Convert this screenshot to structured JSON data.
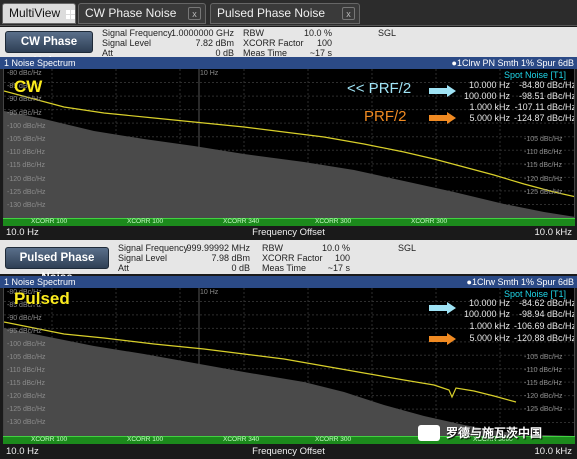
{
  "tabs": [
    {
      "label": "MultiView"
    },
    {
      "label": "CW Phase Noise"
    },
    {
      "label": "Pulsed Phase Noise"
    }
  ],
  "panels": [
    {
      "mode_button": "CW Phase Noise",
      "settings": [
        {
          "label": "Signal Frequency",
          "value": "1.0000000 GHz"
        },
        {
          "label": "Signal Level",
          "value": "7.82 dBm"
        },
        {
          "label": "Att",
          "value": "0 dB"
        },
        {
          "label": "RBW",
          "value": "10.0 %"
        },
        {
          "label": "XCORR Factor",
          "value": "100"
        },
        {
          "label": "Meas Time",
          "value": "~17 s"
        }
      ],
      "sgl": "SGL",
      "spectrum_title": "1 Noise Spectrum",
      "trace_info": "1Clrw PN Smth 1% Spur 6dB",
      "big_label": "CW",
      "y_ticks": [
        "-80 dBc/Hz",
        "-85 dBc/Hz",
        "-90 dBc/Hz",
        "-95 dBc/Hz",
        "-100 dBc/Hz",
        "-105 dBc/Hz",
        "-110 dBc/Hz",
        "-115 dBc/Hz",
        "-120 dBc/Hz",
        "-125 dBc/Hz",
        "-130 dBc/Hz"
      ],
      "top_tick": "10 Hz",
      "spot_title": "Spot Noise [T1]",
      "spot": [
        {
          "f": "10.000 Hz",
          "v": "-84.80 dBc/Hz"
        },
        {
          "f": "100.000 Hz",
          "v": "-98.51 dBc/Hz"
        },
        {
          "f": "1.000 kHz",
          "v": "-107.11 dBc/Hz"
        },
        {
          "f": "5.000 kHz",
          "v": "-124.87 dBc/Hz"
        }
      ],
      "annotations": [
        "<< PRF/2",
        "PRF/2"
      ],
      "xcorr": [
        "XCORR 100",
        "XCORR 100",
        "XCORR 340",
        "XCORR 300",
        "XCORR 300"
      ],
      "x_start": "10.0 Hz",
      "x_label": "Frequency Offset",
      "x_stop": "10.0 kHz"
    },
    {
      "mode_button": "Pulsed Phase Noise",
      "settings": [
        {
          "label": "Signal Frequency",
          "value": "999.99992 MHz"
        },
        {
          "label": "Signal Level",
          "value": "7.98 dBm"
        },
        {
          "label": "Att",
          "value": "0 dB"
        },
        {
          "label": "RBW",
          "value": "10.0 %"
        },
        {
          "label": "XCORR Factor",
          "value": "100"
        },
        {
          "label": "Meas Time",
          "value": "~17 s"
        }
      ],
      "sgl": "SGL",
      "spectrum_title": "1 Noise Spectrum",
      "trace_info": "1Clrw Smth 1% Spur 6dB",
      "big_label": "Pulsed",
      "y_ticks": [
        "-80 dBc/Hz",
        "-85 dBc/Hz",
        "-90 dBc/Hz",
        "-95 dBc/Hz",
        "-100 dBc/Hz",
        "-105 dBc/Hz",
        "-110 dBc/Hz",
        "-115 dBc/Hz",
        "-120 dBc/Hz",
        "-125 dBc/Hz",
        "-130 dBc/Hz"
      ],
      "top_tick": "10 Hz",
      "spot_title": "Spot Noise [T1]",
      "spot": [
        {
          "f": "10.000 Hz",
          "v": "-84.62 dBc/Hz"
        },
        {
          "f": "100.000 Hz",
          "v": "-98.94 dBc/Hz"
        },
        {
          "f": "1.000 kHz",
          "v": "-106.69 dBc/Hz"
        },
        {
          "f": "5.000 kHz",
          "v": "-120.88 dBc/Hz"
        }
      ],
      "xcorr": [
        "XCORR 100",
        "XCORR 100",
        "XCORR 340",
        "XCORR 300",
        "XCORR 3000"
      ],
      "x_start": "10.0 Hz",
      "x_label": "Frequency Offset",
      "x_stop": "10.0 kHz"
    }
  ],
  "watermark": "罗德与施瓦茨中国",
  "colors": {
    "trace": "#d8cf2a",
    "noise_floor": "#4a4a4a",
    "spectrum_bar": "#2b4a86",
    "cyan_arrow": "#9fe3f5",
    "orange_arrow": "#f08a22",
    "green_bar": "#1c8a1c"
  }
}
